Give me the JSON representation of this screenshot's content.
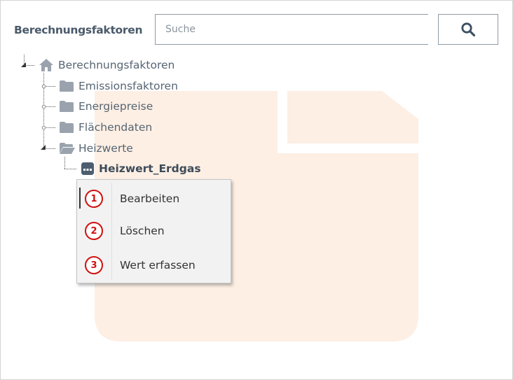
{
  "panel": {
    "title": "Berechnungsfaktoren"
  },
  "search": {
    "placeholder": "Suche",
    "value": ""
  },
  "tree": {
    "root": {
      "label": "Berechnungsfaktoren",
      "icon": "home-icon"
    },
    "children": [
      {
        "label": "Emissionsfaktoren",
        "icon": "folder-icon"
      },
      {
        "label": "Energiepreise",
        "icon": "folder-icon"
      },
      {
        "label": "Flächendaten",
        "icon": "folder-icon"
      },
      {
        "label": "Heizwerte",
        "icon": "folder-open-icon",
        "expanded": true,
        "children": [
          {
            "label": "Heizwert_Erdgas",
            "icon": "data-record-icon",
            "selected": true
          }
        ]
      }
    ]
  },
  "context_menu": {
    "items": [
      {
        "badge": "1",
        "label": "Bearbeiten"
      },
      {
        "badge": "2",
        "label": "Löschen"
      },
      {
        "badge": "3",
        "label": "Wert erfassen"
      }
    ]
  },
  "colors": {
    "badge_red": "#d11010",
    "watermark_peach": "#fdefe4",
    "folder_gray": "#9aa3ad",
    "text": "#566573"
  }
}
